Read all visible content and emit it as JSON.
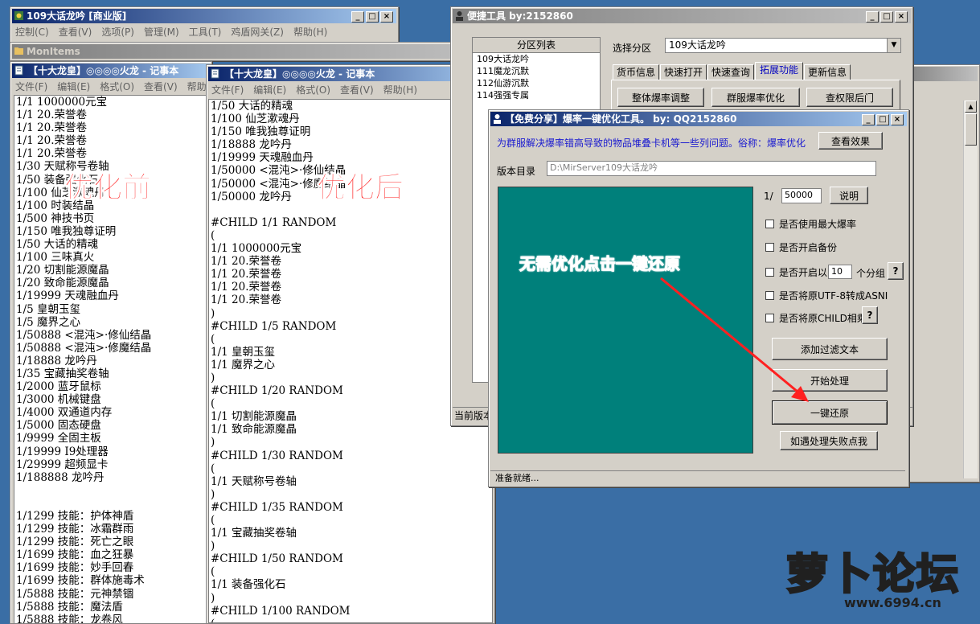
{
  "main_app": {
    "title": "109大话龙吟 [商业版]",
    "menu": [
      "控制(C)",
      "查看(V)",
      "选项(P)",
      "管理(M)",
      "工具(T)",
      "鸡盾网关(Z)",
      "帮助(H)"
    ],
    "mon_bar": "MonItems"
  },
  "notepad_left": {
    "title": "【十大龙皇】◎◎◎◎火龙 - 记事本",
    "menu": [
      "文件(F)",
      "编辑(E)",
      "格式(O)",
      "查看(V)",
      "帮助(H)"
    ],
    "text": "1/1 1000000元宝\n1/1 20.荣誉卷\n1/1 20.荣誉卷\n1/1 20.荣誉卷\n1/1 20.荣誉卷\n1/30 天赋称号卷轴\n1/50 装备强化石\n1/100 仙芝漱魂丹\n1/100 时装结晶\n1/500 神技书页\n1/150 唯我独尊证明\n1/50 大话的精魂\n1/100 三味真火\n1/20 切割能源魔晶\n1/20 致命能源魔晶\n1/19999 天魂融血丹\n1/5 皇朝玉玺\n1/5 魔界之心\n1/50888 <混沌>·修仙结晶\n1/50888 <混沌>·修魔结晶\n1/18888 龙吟丹\n1/35 宝藏抽奖卷轴\n1/2000 蓝牙鼠标\n1/3000 机械键盘\n1/4000 双通道内存\n1/5000 固态硬盘\n1/9999 全固主板\n1/19999 I9处理器\n1/29999 超频显卡\n1/188888 龙吟丹\n\n\n1/1299 技能：护体神盾\n1/1299 技能：冰霜群雨\n1/1299 技能：死亡之眼\n1/1699 技能：血之狂暴\n1/1699 技能：妙手回春\n1/1699 技能：群体施毒术\n1/5888 技能：元神禁锢\n1/5888 技能：魔法盾\n1/5888 技能：龙卷风",
    "overlay": "优化前"
  },
  "notepad_right": {
    "title": "【十大龙皇】◎◎◎◎火龙 - 记事本",
    "menu": [
      "文件(F)",
      "编辑(E)",
      "格式(O)",
      "查看(V)",
      "帮助(H)"
    ],
    "text": "1/50 大话的精魂\n1/100 仙芝漱魂丹\n1/150 唯我独尊证明\n1/18888 龙吟丹\n1/19999 天魂融血丹\n1/50000 <混沌>·修仙结晶\n1/50000 <混沌>·修魔结晶\n1/50000 龙吟丹\n\n#CHILD 1/1 RANDOM\n(\n1/1 1000000元宝\n1/1 20.荣誉卷\n1/1 20.荣誉卷\n1/1 20.荣誉卷\n1/1 20.荣誉卷\n)\n#CHILD 1/5 RANDOM\n(\n1/1 皇朝玉玺\n1/1 魔界之心\n)\n#CHILD 1/20 RANDOM\n(\n1/1 切割能源魔晶\n1/1 致命能源魔晶\n)\n#CHILD 1/30 RANDOM\n(\n1/1 天赋称号卷轴\n)\n#CHILD 1/35 RANDOM\n(\n1/1 宝藏抽奖卷轴\n)\n#CHILD 1/50 RANDOM\n(\n1/1 装备强化石\n)\n#CHILD 1/100 RANDOM\n(",
    "overlay": "优化后"
  },
  "shortcut_tool": {
    "title": "便捷工具  by:2152860",
    "partition_header": "分区列表",
    "partitions": [
      "109大话龙吟",
      "111魔龙沉默",
      "112仙游沉默",
      "114强强专属"
    ],
    "select_label": "选择分区",
    "select_value": "109大话龙吟",
    "tabs": [
      "货币信息",
      "快速打开",
      "快速查询",
      "拓展功能",
      "更新信息"
    ],
    "buttons": [
      "整体爆率调整",
      "群服爆率优化",
      "查权限后门"
    ],
    "status": "当前版本"
  },
  "drop_tool": {
    "title": "【免费分享】爆率一键优化工具。   by: QQ2152860",
    "info": "为群服解决爆率错高导致的物品堆叠卡机等一些列问题。俗称：爆率优化",
    "view_button": "查看效果",
    "dir_label": "版本目录",
    "dir_value": "D:\\MirServer109大话龙吟",
    "ratio_prefix": "1/",
    "ratio_value": "50000",
    "explain_button": "说明",
    "checks": [
      "是否使用最大爆率",
      "是否开启备份",
      "是否开启以",
      "是否将原UTF-8转成ASNI",
      "是否将原CHILD相乘"
    ],
    "group_value": "10",
    "group_suffix": "个分组",
    "question": "?",
    "actions": [
      "添加过滤文本",
      "开始处理",
      "一键还原",
      "如遇处理失败点我"
    ],
    "status": "准备就绪...",
    "overlay": "无需优化点击一键还原"
  },
  "watermark": {
    "text": "萝卜论坛",
    "url": "www.6994.cn"
  }
}
